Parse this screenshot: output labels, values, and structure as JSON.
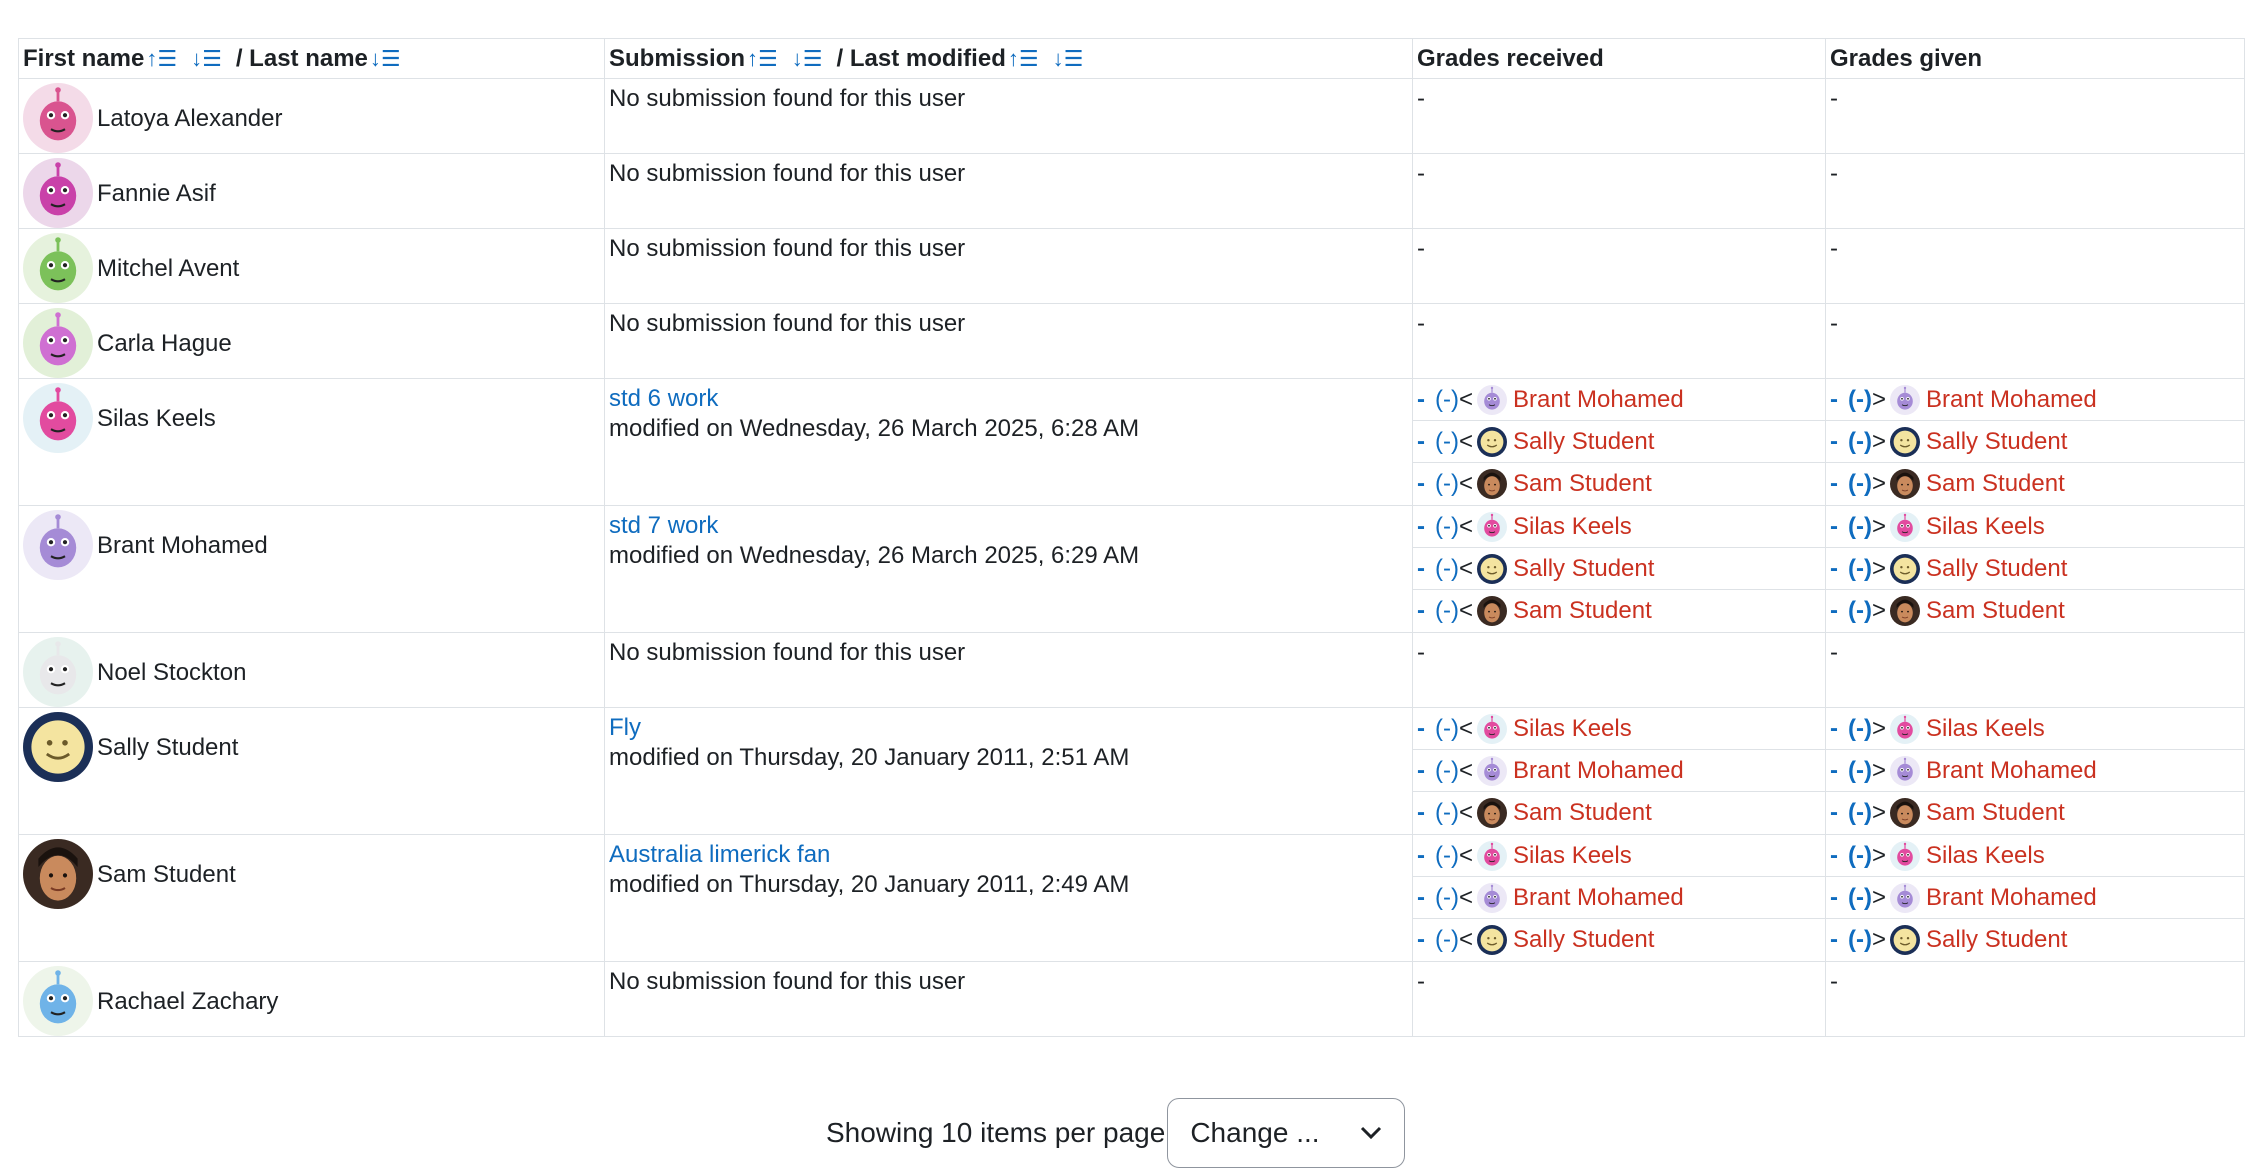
{
  "table": {
    "headers": {
      "first_name": "First name",
      "last_name": "/ Last name",
      "submission": "Submission",
      "last_modified": "/ Last modified",
      "grades_received": "Grades received",
      "grades_given": "Grades given"
    },
    "rows": [
      {
        "name": "Latoya Alexander",
        "avatar": "pink-robot-avatar",
        "submission": "No submission found for this user",
        "received": "-",
        "given": "-"
      },
      {
        "name": "Fannie Asif",
        "avatar": "magenta-monster-avatar",
        "submission": "No submission found for this user",
        "received": "-",
        "given": "-"
      },
      {
        "name": "Mitchel Avent",
        "avatar": "green-alien-avatar",
        "submission": "No submission found for this user",
        "received": "-",
        "given": "-"
      },
      {
        "name": "Carla Hague",
        "avatar": "purple-blob-avatar",
        "submission": "No submission found for this user",
        "received": "-",
        "given": "-"
      },
      {
        "name": "Silas Keels",
        "avatar": "pink-monster-avatar",
        "submission_title": "std 6 work",
        "submission_modified": "modified on Wednesday, 26 March 2025, 6:28 AM",
        "received": [
          {
            "dash": "-",
            "value": "(-)",
            "arrow": "<",
            "user": "Brant Mohamed"
          },
          {
            "dash": "-",
            "value": "(-)",
            "arrow": "<",
            "user": "Sally Student"
          },
          {
            "dash": "-",
            "value": "(-)",
            "arrow": "<",
            "user": "Sam Student"
          }
        ],
        "given": [
          {
            "dash": "-",
            "value": "(-)",
            "arrow": ">",
            "user": "Brant Mohamed"
          },
          {
            "dash": "-",
            "value": "(-)",
            "arrow": ">",
            "user": "Sally Student"
          },
          {
            "dash": "-",
            "value": "(-)",
            "arrow": ">",
            "user": "Sam Student"
          }
        ]
      },
      {
        "name": "Brant Mohamed",
        "avatar": "lavender-crab-avatar",
        "submission_title": "std 7 work",
        "submission_modified": "modified on Wednesday, 26 March 2025, 6:29 AM",
        "received": [
          {
            "dash": "-",
            "value": "(-)",
            "arrow": "<",
            "user": "Silas Keels"
          },
          {
            "dash": "-",
            "value": "(-)",
            "arrow": "<",
            "user": "Sally Student"
          },
          {
            "dash": "-",
            "value": "(-)",
            "arrow": "<",
            "user": "Sam Student"
          }
        ],
        "given": [
          {
            "dash": "-",
            "value": "(-)",
            "arrow": ">",
            "user": "Silas Keels"
          },
          {
            "dash": "-",
            "value": "(-)",
            "arrow": ">",
            "user": "Sally Student"
          },
          {
            "dash": "-",
            "value": "(-)",
            "arrow": ">",
            "user": "Sam Student"
          }
        ]
      },
      {
        "name": "Noel Stockton",
        "avatar": "white-crab-avatar",
        "submission": "No submission found for this user",
        "received": "-",
        "given": "-"
      },
      {
        "name": "Sally Student",
        "avatar": "smiley-moon-avatar",
        "submission_title": "Fly",
        "submission_modified": "modified on Thursday, 20 January 2011, 2:51 AM",
        "received": [
          {
            "dash": "-",
            "value": "(-)",
            "arrow": "<",
            "user": "Silas Keels"
          },
          {
            "dash": "-",
            "value": "(-)",
            "arrow": "<",
            "user": "Brant Mohamed"
          },
          {
            "dash": "-",
            "value": "(-)",
            "arrow": "<",
            "user": "Sam Student"
          }
        ],
        "given": [
          {
            "dash": "-",
            "value": "(-)",
            "arrow": ">",
            "user": "Silas Keels"
          },
          {
            "dash": "-",
            "value": "(-)",
            "arrow": ">",
            "user": "Brant Mohamed"
          },
          {
            "dash": "-",
            "value": "(-)",
            "arrow": ">",
            "user": "Sam Student"
          }
        ]
      },
      {
        "name": "Sam Student",
        "avatar": "photo-avatar",
        "submission_title": "Australia limerick fan",
        "submission_modified": "modified on Thursday, 20 January 2011, 2:49 AM",
        "received": [
          {
            "dash": "-",
            "value": "(-)",
            "arrow": "<",
            "user": "Silas Keels"
          },
          {
            "dash": "-",
            "value": "(-)",
            "arrow": "<",
            "user": "Brant Mohamed"
          },
          {
            "dash": "-",
            "value": "(-)",
            "arrow": "<",
            "user": "Sally Student"
          }
        ],
        "given": [
          {
            "dash": "-",
            "value": "(-)",
            "arrow": ">",
            "user": "Silas Keels"
          },
          {
            "dash": "-",
            "value": "(-)",
            "arrow": ">",
            "user": "Brant Mohamed"
          },
          {
            "dash": "-",
            "value": "(-)",
            "arrow": ">",
            "user": "Sally Student"
          }
        ]
      },
      {
        "name": "Rachael Zachary",
        "avatar": "blue-blob-avatar",
        "submission": "No submission found for this user",
        "received": "-",
        "given": "-"
      }
    ]
  },
  "pager": {
    "text": "Showing 10 items per page",
    "select_value": "Change ..."
  },
  "colors": {
    "link": "#0f6cbf",
    "user_link": "#ca3120",
    "border": "#dee2e6"
  }
}
